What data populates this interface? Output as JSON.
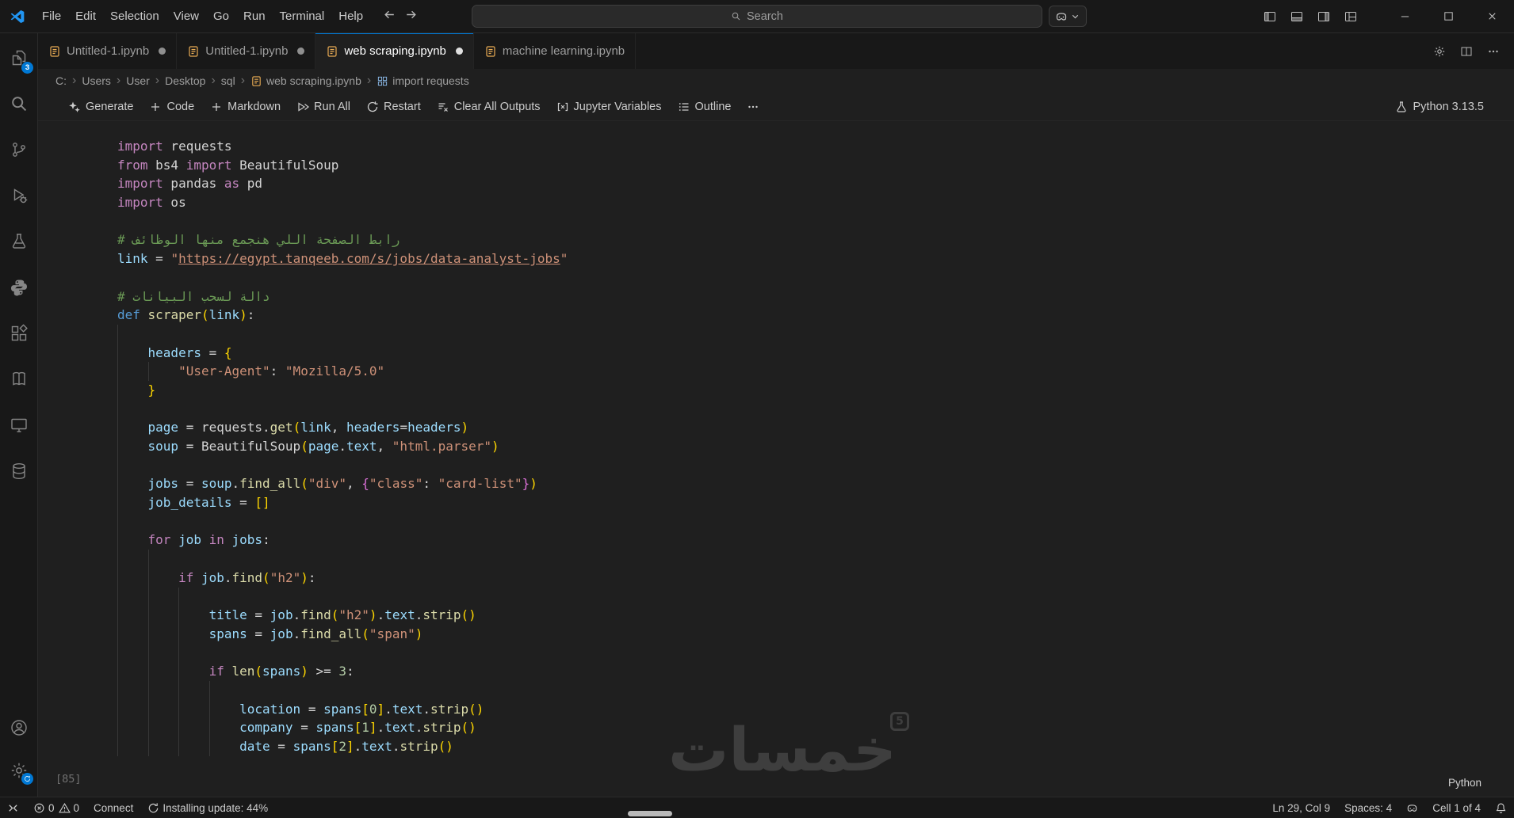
{
  "colors": {
    "accent": "#0078d4",
    "chrome_bg": "#181818",
    "editor_bg": "#1f1f1f",
    "border": "#2b2b2b",
    "watermark": "#3e3e3e",
    "notebook_icon": "#e8ab53"
  },
  "window": {
    "search_placeholder": "Search"
  },
  "titlebar": {
    "menus": [
      {
        "label": "File"
      },
      {
        "label": "Edit"
      },
      {
        "label": "Selection"
      },
      {
        "label": "View"
      },
      {
        "label": "Go"
      },
      {
        "label": "Run"
      },
      {
        "label": "Terminal"
      },
      {
        "label": "Help"
      }
    ]
  },
  "tabs": [
    {
      "label": "Untitled-1.ipynb",
      "icon": "notebook-icon",
      "modified": true,
      "active": false
    },
    {
      "label": "Untitled-1.ipynb",
      "icon": "notebook-icon",
      "modified": true,
      "active": false
    },
    {
      "label": "web scraping.ipynb",
      "icon": "notebook-icon",
      "modified": true,
      "active": true
    },
    {
      "label": "machine learning.ipynb",
      "icon": "notebook-icon",
      "modified": false,
      "active": false
    }
  ],
  "breadcrumbs": [
    {
      "label": "C:"
    },
    {
      "label": "Users"
    },
    {
      "label": "User"
    },
    {
      "label": "Desktop"
    },
    {
      "label": "sql"
    },
    {
      "label": "web scraping.ipynb",
      "icon": "notebook-icon"
    },
    {
      "label": "import requests",
      "icon": "cell-symbol-icon"
    }
  ],
  "notebook_toolbar": {
    "left": [
      {
        "icon": "sparkle-icon",
        "label": "Generate"
      },
      {
        "icon": "plus-icon",
        "label": "Code"
      },
      {
        "icon": "plus-icon",
        "label": "Markdown"
      },
      {
        "icon": "run-all-icon",
        "label": "Run All"
      },
      {
        "icon": "restart-icon",
        "label": "Restart"
      },
      {
        "icon": "clear-outputs-icon",
        "label": "Clear All Outputs"
      },
      {
        "icon": "variables-icon",
        "label": "Jupyter Variables"
      },
      {
        "icon": "outline-icon",
        "label": "Outline"
      },
      {
        "icon": "ellipsis-icon",
        "label": ""
      }
    ],
    "kernel": {
      "icon": "kernel-picker-icon",
      "label": "Python 3.13.5"
    }
  },
  "activity_bar": {
    "top": [
      {
        "icon": "explorer-icon",
        "badge": "3"
      },
      {
        "icon": "search-icon"
      },
      {
        "icon": "source-control-icon"
      },
      {
        "icon": "run-debug-icon"
      },
      {
        "icon": "testing-icon"
      },
      {
        "icon": "python-icon"
      },
      {
        "icon": "extensions-icon"
      },
      {
        "icon": "notebook-book-icon"
      },
      {
        "icon": "remote-explorer-icon"
      },
      {
        "icon": "database-icon"
      }
    ],
    "bottom": [
      {
        "icon": "account-icon"
      },
      {
        "icon": "settings-gear-icon",
        "badge_icon": "sync-icon"
      }
    ]
  },
  "editor": {
    "execution_count": "[85]",
    "language_indicator": "Python",
    "code_lines": [
      {
        "t": [
          [
            "kw",
            "import"
          ],
          [
            "txt",
            " requests"
          ]
        ]
      },
      {
        "t": [
          [
            "kw",
            "from"
          ],
          [
            "txt",
            " bs4 "
          ],
          [
            "kw",
            "import"
          ],
          [
            "txt",
            " BeautifulSoup"
          ]
        ]
      },
      {
        "t": [
          [
            "kw",
            "import"
          ],
          [
            "txt",
            " pandas "
          ],
          [
            "kw",
            "as"
          ],
          [
            "txt",
            " pd"
          ]
        ]
      },
      {
        "t": [
          [
            "kw",
            "import"
          ],
          [
            "txt",
            " os"
          ]
        ]
      },
      {
        "g": 0
      },
      {
        "t": [
          [
            "com",
            "# رابط الصفحة اللي هنجمع منها الوظائف"
          ]
        ]
      },
      {
        "t": [
          [
            "var",
            "link"
          ],
          [
            "txt",
            " = "
          ],
          [
            "str",
            "\""
          ],
          [
            "url",
            "https://egypt.tanqeeb.com/s/jobs/data-analyst-jobs"
          ],
          [
            "str",
            "\""
          ]
        ]
      },
      {
        "g": 0
      },
      {
        "t": [
          [
            "com",
            "# دالة لسحب البيانات"
          ]
        ]
      },
      {
        "t": [
          [
            "def",
            "def"
          ],
          [
            "txt",
            " "
          ],
          [
            "fn",
            "scraper"
          ],
          [
            "b1",
            "("
          ],
          [
            "var",
            "link"
          ],
          [
            "b1",
            ")"
          ],
          [
            "txt",
            ":"
          ]
        ]
      },
      {
        "g": 1
      },
      {
        "i": 4,
        "t": [
          [
            "var",
            "headers"
          ],
          [
            "txt",
            " = "
          ],
          [
            "b1",
            "{"
          ]
        ]
      },
      {
        "i": 8,
        "t": [
          [
            "str",
            "\"User-Agent\""
          ],
          [
            "txt",
            ": "
          ],
          [
            "str",
            "\"Mozilla/5.0\""
          ]
        ]
      },
      {
        "i": 4,
        "t": [
          [
            "b1",
            "}"
          ]
        ]
      },
      {
        "g": 1
      },
      {
        "i": 4,
        "t": [
          [
            "var",
            "page"
          ],
          [
            "txt",
            " = requests."
          ],
          [
            "fn",
            "get"
          ],
          [
            "b1",
            "("
          ],
          [
            "var",
            "link"
          ],
          [
            "txt",
            ", "
          ],
          [
            "var",
            "headers"
          ],
          [
            "txt",
            "="
          ],
          [
            "var",
            "headers"
          ],
          [
            "b1",
            ")"
          ]
        ]
      },
      {
        "i": 4,
        "t": [
          [
            "var",
            "soup"
          ],
          [
            "txt",
            " = BeautifulSoup"
          ],
          [
            "b1",
            "("
          ],
          [
            "var",
            "page"
          ],
          [
            "txt",
            "."
          ],
          [
            "var",
            "text"
          ],
          [
            "txt",
            ", "
          ],
          [
            "str",
            "\"html.parser\""
          ],
          [
            "b1",
            ")"
          ]
        ]
      },
      {
        "g": 1
      },
      {
        "i": 4,
        "t": [
          [
            "var",
            "jobs"
          ],
          [
            "txt",
            " = "
          ],
          [
            "var",
            "soup"
          ],
          [
            "txt",
            "."
          ],
          [
            "fn",
            "find_all"
          ],
          [
            "b1",
            "("
          ],
          [
            "str",
            "\"div\""
          ],
          [
            "txt",
            ", "
          ],
          [
            "b2",
            "{"
          ],
          [
            "str",
            "\"class\""
          ],
          [
            "txt",
            ": "
          ],
          [
            "str",
            "\"card-list\""
          ],
          [
            "b2",
            "}"
          ],
          [
            "b1",
            ")"
          ]
        ]
      },
      {
        "i": 4,
        "t": [
          [
            "var",
            "job_details"
          ],
          [
            "txt",
            " = "
          ],
          [
            "b1",
            "[]"
          ]
        ]
      },
      {
        "g": 1
      },
      {
        "i": 4,
        "t": [
          [
            "kw",
            "for"
          ],
          [
            "txt",
            " "
          ],
          [
            "var",
            "job"
          ],
          [
            "txt",
            " "
          ],
          [
            "kw",
            "in"
          ],
          [
            "txt",
            " "
          ],
          [
            "var",
            "jobs"
          ],
          [
            "txt",
            ":"
          ]
        ]
      },
      {
        "g": 2
      },
      {
        "i": 8,
        "t": [
          [
            "kw",
            "if"
          ],
          [
            "txt",
            " "
          ],
          [
            "var",
            "job"
          ],
          [
            "txt",
            "."
          ],
          [
            "fn",
            "find"
          ],
          [
            "b1",
            "("
          ],
          [
            "str",
            "\"h2\""
          ],
          [
            "b1",
            ")"
          ],
          [
            "txt",
            ":"
          ]
        ]
      },
      {
        "g": 3
      },
      {
        "i": 12,
        "t": [
          [
            "var",
            "title"
          ],
          [
            "txt",
            " = "
          ],
          [
            "var",
            "job"
          ],
          [
            "txt",
            "."
          ],
          [
            "fn",
            "find"
          ],
          [
            "b1",
            "("
          ],
          [
            "str",
            "\"h2\""
          ],
          [
            "b1",
            ")"
          ],
          [
            "txt",
            "."
          ],
          [
            "var",
            "text"
          ],
          [
            "txt",
            "."
          ],
          [
            "fn",
            "strip"
          ],
          [
            "b1",
            "()"
          ]
        ]
      },
      {
        "i": 12,
        "t": [
          [
            "var",
            "spans"
          ],
          [
            "txt",
            " = "
          ],
          [
            "var",
            "job"
          ],
          [
            "txt",
            "."
          ],
          [
            "fn",
            "find_all"
          ],
          [
            "b1",
            "("
          ],
          [
            "str",
            "\"span\""
          ],
          [
            "b1",
            ")"
          ]
        ]
      },
      {
        "g": 3
      },
      {
        "i": 12,
        "t": [
          [
            "kw",
            "if"
          ],
          [
            "txt",
            " "
          ],
          [
            "fn",
            "len"
          ],
          [
            "b1",
            "("
          ],
          [
            "var",
            "spans"
          ],
          [
            "b1",
            ")"
          ],
          [
            "txt",
            " >= "
          ],
          [
            "num",
            "3"
          ],
          [
            "txt",
            ":"
          ]
        ]
      },
      {
        "g": 4
      },
      {
        "i": 16,
        "t": [
          [
            "var",
            "location"
          ],
          [
            "txt",
            " = "
          ],
          [
            "var",
            "spans"
          ],
          [
            "b1",
            "["
          ],
          [
            "num",
            "0"
          ],
          [
            "b1",
            "]"
          ],
          [
            "txt",
            "."
          ],
          [
            "var",
            "text"
          ],
          [
            "txt",
            "."
          ],
          [
            "fn",
            "strip"
          ],
          [
            "b1",
            "()"
          ]
        ]
      },
      {
        "i": 16,
        "t": [
          [
            "var",
            "company"
          ],
          [
            "txt",
            " = "
          ],
          [
            "var",
            "spans"
          ],
          [
            "b1",
            "["
          ],
          [
            "num",
            "1"
          ],
          [
            "b1",
            "]"
          ],
          [
            "txt",
            "."
          ],
          [
            "var",
            "text"
          ],
          [
            "txt",
            "."
          ],
          [
            "fn",
            "strip"
          ],
          [
            "b1",
            "()"
          ]
        ]
      },
      {
        "i": 16,
        "t": [
          [
            "var",
            "date"
          ],
          [
            "txt",
            " = "
          ],
          [
            "var",
            "spans"
          ],
          [
            "b1",
            "["
          ],
          [
            "num",
            "2"
          ],
          [
            "b1",
            "]"
          ],
          [
            "txt",
            "."
          ],
          [
            "var",
            "text"
          ],
          [
            "txt",
            "."
          ],
          [
            "fn",
            "strip"
          ],
          [
            "b1",
            "()"
          ]
        ]
      }
    ]
  },
  "watermark": {
    "text": "خمسات",
    "badge": "5"
  },
  "status_bar": {
    "left": [
      {
        "name": "remote",
        "segments": [
          {
            "icon": "remote-icon"
          }
        ]
      },
      {
        "name": "problems",
        "segments": [
          {
            "icon": "error-icon",
            "label": "0"
          },
          {
            "icon": "warning-icon",
            "label": "0"
          }
        ]
      },
      {
        "name": "connect",
        "segments": [
          {
            "label": "Connect"
          }
        ]
      },
      {
        "name": "update-progress",
        "spin": true,
        "segments": [
          {
            "icon": "sync-icon",
            "label": "Installing update: 44%"
          }
        ]
      }
    ],
    "right": [
      {
        "name": "cursor-position",
        "segments": [
          {
            "label": "Ln 29, Col 9"
          }
        ]
      },
      {
        "name": "indentation",
        "segments": [
          {
            "label": "Spaces: 4"
          }
        ]
      },
      {
        "name": "copilot",
        "segments": [
          {
            "icon": "copilot-icon"
          }
        ]
      },
      {
        "name": "cell-indicator",
        "segments": [
          {
            "label": "Cell 1 of 4"
          }
        ]
      },
      {
        "name": "notifications",
        "segments": [
          {
            "icon": "bell-icon"
          }
        ]
      }
    ]
  }
}
